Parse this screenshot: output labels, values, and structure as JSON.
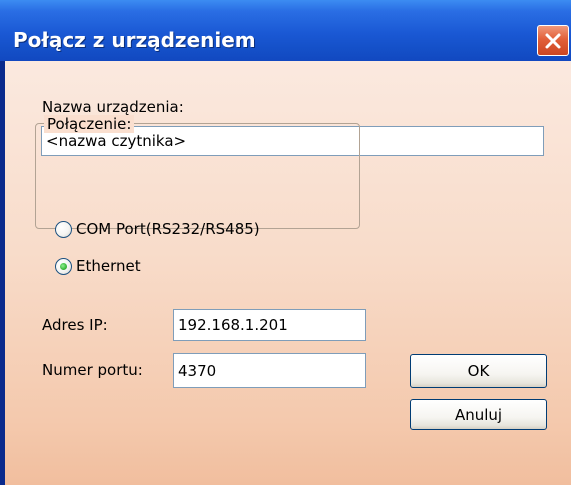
{
  "window": {
    "title": "Połącz z urządzeniem",
    "close_icon": "close-icon"
  },
  "device_name": {
    "label": "Nazwa urządzenia:",
    "value": "<nazwa czytnika>"
  },
  "connection": {
    "group_label": "Połączenie:",
    "options": [
      {
        "label": "COM Port(RS232/RS485)",
        "selected": false
      },
      {
        "label": "Ethernet",
        "selected": true
      }
    ]
  },
  "ip_address": {
    "label": "Adres IP:",
    "value": "192.168.1.201"
  },
  "port": {
    "label": "Numer portu:",
    "value": "4370"
  },
  "buttons": {
    "ok": "OK",
    "cancel": "Anuluj"
  },
  "colors": {
    "titlebar": "#1a58d4",
    "close_button": "#e2603a",
    "dialog_bg": "#f8dcca",
    "radio_selected": "#3bb83b"
  }
}
